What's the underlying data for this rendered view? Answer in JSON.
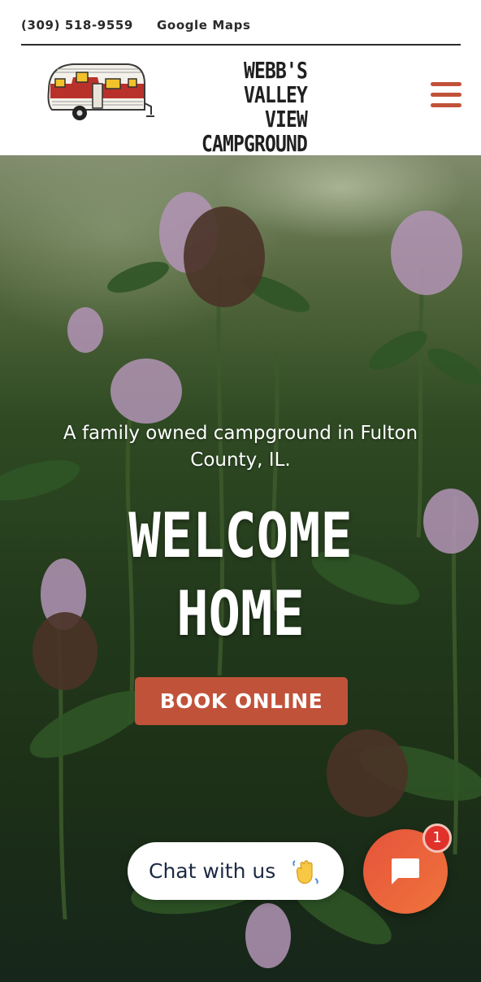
{
  "topbar": {
    "phone": "(309) 518-9559",
    "maps": "Google Maps"
  },
  "header": {
    "logo_lines": [
      "WEBB'S",
      "VALLEY VIEW",
      "CAMPGROUND"
    ],
    "logo_icon": "vintage-camper-trailer",
    "menu_icon": "hamburger-menu-icon"
  },
  "hero": {
    "tagline": "A family owned campground in Fulton County, IL.",
    "headline_lines": [
      "WELCOME",
      "HOME"
    ],
    "cta_label": "BOOK ONLINE",
    "background": "clover-field-photo"
  },
  "chat": {
    "label": "Chat with us",
    "emoji_icon": "waving-hand-icon",
    "fab_icon": "chat-bubble-icon",
    "badge_count": "1"
  },
  "colors": {
    "accent": "#c1523a",
    "chat_gradient_start": "#e5533b",
    "chat_gradient_end": "#f0743c",
    "badge": "#e0312b",
    "text_dark": "#1f1f1f"
  }
}
